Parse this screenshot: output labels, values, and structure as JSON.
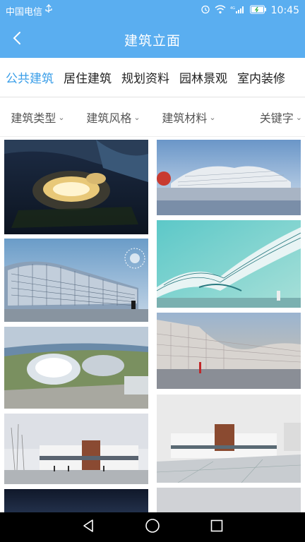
{
  "status_bar": {
    "carrier": "中国电信",
    "time": "10:45",
    "icons": [
      "usb-icon",
      "alarm-icon",
      "wifi-icon",
      "signal-icon",
      "battery-icon"
    ]
  },
  "header": {
    "title": "建筑立面",
    "back_icon": "back-arrow-icon"
  },
  "tabs": [
    {
      "label": "公共建筑",
      "active": true
    },
    {
      "label": "居住建筑",
      "active": false
    },
    {
      "label": "规划资料",
      "active": false
    },
    {
      "label": "园林景观",
      "active": false
    },
    {
      "label": "室内装修",
      "active": false
    }
  ],
  "filters": [
    {
      "label": "建筑类型"
    },
    {
      "label": "建筑风格"
    },
    {
      "label": "建筑材料"
    },
    {
      "label": "关键字"
    }
  ],
  "colors": {
    "header_bg": "#5aaef0",
    "active_tab": "#3a9ee8"
  },
  "gallery": {
    "images": [
      {
        "name": "night-stadium-aerial-image"
      },
      {
        "name": "lattice-shell-building-image"
      },
      {
        "name": "fireworks-shell-pavilion-image"
      },
      {
        "name": "teal-wave-canopy-image"
      },
      {
        "name": "riverside-complex-aerial-image"
      },
      {
        "name": "pixel-facade-wave-image"
      },
      {
        "name": "white-cultural-center-image"
      },
      {
        "name": "tower-block-plaza-image"
      },
      {
        "name": "night-sky-partial-image"
      },
      {
        "name": "grey-sky-partial-image"
      }
    ]
  },
  "nav": {
    "back_icon": "nav-back-icon",
    "home_icon": "nav-home-icon",
    "recent_icon": "nav-recent-icon"
  }
}
